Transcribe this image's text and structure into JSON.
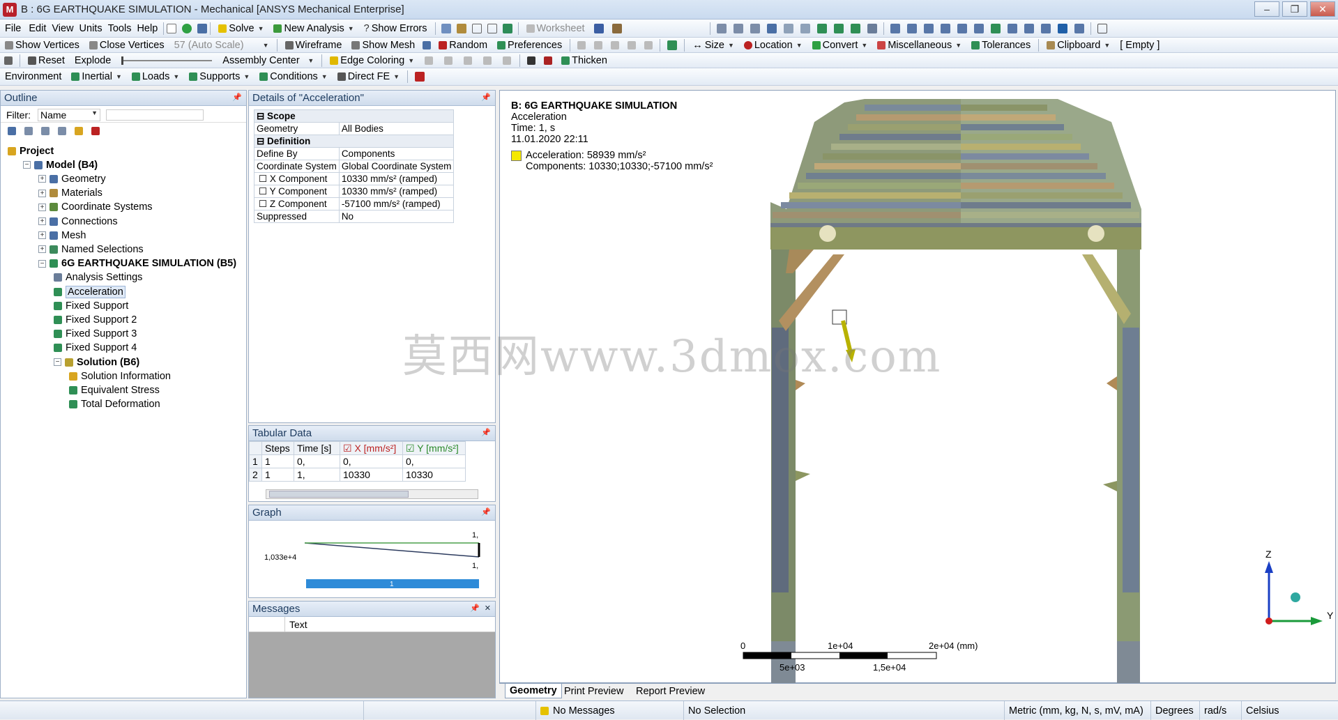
{
  "window": {
    "title": "B : 6G EARTHQUAKE SIMULATION - Mechanical [ANSYS Mechanical Enterprise]",
    "app_logo": "M",
    "controls": [
      "–",
      "❐",
      "✕"
    ]
  },
  "menu": {
    "items": [
      "File",
      "Edit",
      "View",
      "Units",
      "Tools",
      "Help"
    ],
    "solve": "Solve",
    "new_analysis": "New Analysis",
    "show_errors": "Show Errors",
    "worksheet": "Worksheet"
  },
  "toolbar2": {
    "show_vertices": "Show Vertices",
    "close_vertices": "Close Vertices",
    "auto_scale": "57 (Auto Scale)",
    "wireframe": "Wireframe",
    "show_mesh": "Show Mesh",
    "random": "Random",
    "preferences": "Preferences",
    "size": "Size",
    "location": "Location",
    "convert": "Convert",
    "miscellaneous": "Miscellaneous",
    "tolerances": "Tolerances",
    "clipboard": "Clipboard",
    "empty": "[ Empty ]"
  },
  "toolbar3": {
    "reset": "Reset",
    "explode": "Explode",
    "assembly_center": "Assembly Center",
    "edge_coloring": "Edge Coloring",
    "thicken": "Thicken"
  },
  "toolbar4": {
    "environment": "Environment",
    "inertial": "Inertial",
    "loads": "Loads",
    "supports": "Supports",
    "conditions": "Conditions",
    "direct_fe": "Direct FE"
  },
  "outline": {
    "title": "Outline",
    "filter_label": "Filter:",
    "filter_value": "Name",
    "nodes": [
      {
        "label": "Project",
        "bold": true,
        "level": 0
      },
      {
        "label": "Model (B4)",
        "bold": true,
        "level": 1
      },
      {
        "label": "Geometry",
        "level": 2
      },
      {
        "label": "Materials",
        "level": 2
      },
      {
        "label": "Coordinate Systems",
        "level": 2
      },
      {
        "label": "Connections",
        "level": 2
      },
      {
        "label": "Mesh",
        "level": 2
      },
      {
        "label": "Named Selections",
        "level": 2
      },
      {
        "label": "6G EARTHQUAKE SIMULATION (B5)",
        "bold": true,
        "level": 2
      },
      {
        "label": "Analysis Settings",
        "level": 3
      },
      {
        "label": "Acceleration",
        "level": 3,
        "selected": true
      },
      {
        "label": "Fixed Support",
        "level": 3
      },
      {
        "label": "Fixed Support 2",
        "level": 3
      },
      {
        "label": "Fixed Support 3",
        "level": 3
      },
      {
        "label": "Fixed Support 4",
        "level": 3
      },
      {
        "label": "Solution (B6)",
        "bold": true,
        "level": 3
      },
      {
        "label": "Solution Information",
        "level": 4
      },
      {
        "label": "Equivalent Stress",
        "level": 4
      },
      {
        "label": "Total Deformation",
        "level": 4
      }
    ]
  },
  "details": {
    "title": "Details of \"Acceleration\"",
    "groups": [
      {
        "name": "Scope",
        "rows": [
          {
            "k": "Geometry",
            "v": "All Bodies"
          }
        ]
      },
      {
        "name": "Definition",
        "rows": [
          {
            "k": "Define By",
            "v": "Components"
          },
          {
            "k": "Coordinate System",
            "v": "Global Coordinate System"
          },
          {
            "k": "X Component",
            "v": "10330 mm/s²  (ramped)",
            "check": true
          },
          {
            "k": "Y Component",
            "v": "10330 mm/s²  (ramped)",
            "check": true
          },
          {
            "k": "Z Component",
            "v": "-57100 mm/s²  (ramped)",
            "check": true
          },
          {
            "k": "Suppressed",
            "v": "No"
          }
        ]
      }
    ]
  },
  "tabular": {
    "title": "Tabular Data",
    "headers": [
      "",
      "Steps",
      "Time [s]",
      "X [mm/s²]",
      "Y [mm/s²]"
    ],
    "rows": [
      [
        "1",
        "1",
        "0,",
        "0,",
        "0,"
      ],
      [
        "2",
        "1",
        "1,",
        "10330",
        "10330"
      ]
    ]
  },
  "graph": {
    "title": "Graph",
    "y_label": "1,033e+4",
    "top_label": "1,",
    "bottom_label": "1,",
    "bar_label": "1"
  },
  "messages": {
    "title": "Messages",
    "header": "Text"
  },
  "viewport": {
    "title": "B: 6G EARTHQUAKE SIMULATION",
    "subtitle": "Acceleration",
    "time": "Time: 1, s",
    "date": "11.01.2020 22:11",
    "legend_color": "#f5e800",
    "legend_line1": "Acceleration: 58939 mm/s²",
    "legend_line2": "Components: 10330;10330;-57100 mm/s²",
    "scale": [
      "0",
      "1e+04",
      "2e+04 (mm)",
      "5e+03",
      "1,5e+04"
    ],
    "axes": [
      "Z",
      "Y"
    ],
    "watermark": "莫西网www.3dmox.com"
  },
  "view_tabs": [
    "Geometry",
    "Print Preview",
    "Report Preview"
  ],
  "status": {
    "messages": "No Messages",
    "selection": "No Selection",
    "units": "Metric (mm, kg, N, s, mV, mA)",
    "angle": "Degrees",
    "rate": "rad/s",
    "temp": "Celsius"
  }
}
